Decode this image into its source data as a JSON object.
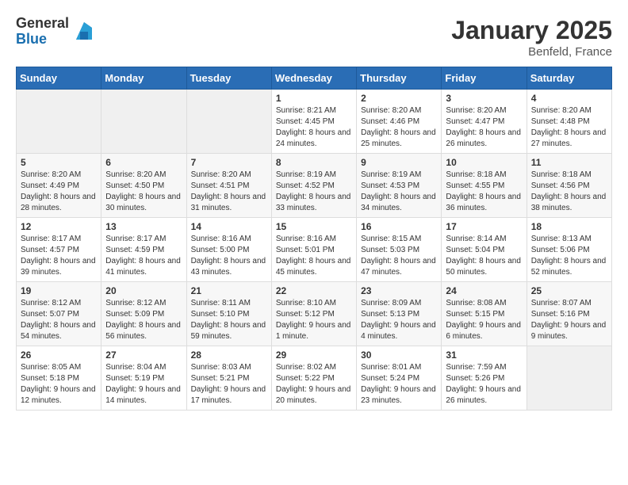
{
  "logo": {
    "general": "General",
    "blue": "Blue"
  },
  "title": "January 2025",
  "location": "Benfeld, France",
  "weekdays": [
    "Sunday",
    "Monday",
    "Tuesday",
    "Wednesday",
    "Thursday",
    "Friday",
    "Saturday"
  ],
  "weeks": [
    [
      {
        "day": "",
        "info": ""
      },
      {
        "day": "",
        "info": ""
      },
      {
        "day": "",
        "info": ""
      },
      {
        "day": "1",
        "info": "Sunrise: 8:21 AM\nSunset: 4:45 PM\nDaylight: 8 hours and 24 minutes."
      },
      {
        "day": "2",
        "info": "Sunrise: 8:20 AM\nSunset: 4:46 PM\nDaylight: 8 hours and 25 minutes."
      },
      {
        "day": "3",
        "info": "Sunrise: 8:20 AM\nSunset: 4:47 PM\nDaylight: 8 hours and 26 minutes."
      },
      {
        "day": "4",
        "info": "Sunrise: 8:20 AM\nSunset: 4:48 PM\nDaylight: 8 hours and 27 minutes."
      }
    ],
    [
      {
        "day": "5",
        "info": "Sunrise: 8:20 AM\nSunset: 4:49 PM\nDaylight: 8 hours and 28 minutes."
      },
      {
        "day": "6",
        "info": "Sunrise: 8:20 AM\nSunset: 4:50 PM\nDaylight: 8 hours and 30 minutes."
      },
      {
        "day": "7",
        "info": "Sunrise: 8:20 AM\nSunset: 4:51 PM\nDaylight: 8 hours and 31 minutes."
      },
      {
        "day": "8",
        "info": "Sunrise: 8:19 AM\nSunset: 4:52 PM\nDaylight: 8 hours and 33 minutes."
      },
      {
        "day": "9",
        "info": "Sunrise: 8:19 AM\nSunset: 4:53 PM\nDaylight: 8 hours and 34 minutes."
      },
      {
        "day": "10",
        "info": "Sunrise: 8:18 AM\nSunset: 4:55 PM\nDaylight: 8 hours and 36 minutes."
      },
      {
        "day": "11",
        "info": "Sunrise: 8:18 AM\nSunset: 4:56 PM\nDaylight: 8 hours and 38 minutes."
      }
    ],
    [
      {
        "day": "12",
        "info": "Sunrise: 8:17 AM\nSunset: 4:57 PM\nDaylight: 8 hours and 39 minutes."
      },
      {
        "day": "13",
        "info": "Sunrise: 8:17 AM\nSunset: 4:59 PM\nDaylight: 8 hours and 41 minutes."
      },
      {
        "day": "14",
        "info": "Sunrise: 8:16 AM\nSunset: 5:00 PM\nDaylight: 8 hours and 43 minutes."
      },
      {
        "day": "15",
        "info": "Sunrise: 8:16 AM\nSunset: 5:01 PM\nDaylight: 8 hours and 45 minutes."
      },
      {
        "day": "16",
        "info": "Sunrise: 8:15 AM\nSunset: 5:03 PM\nDaylight: 8 hours and 47 minutes."
      },
      {
        "day": "17",
        "info": "Sunrise: 8:14 AM\nSunset: 5:04 PM\nDaylight: 8 hours and 50 minutes."
      },
      {
        "day": "18",
        "info": "Sunrise: 8:13 AM\nSunset: 5:06 PM\nDaylight: 8 hours and 52 minutes."
      }
    ],
    [
      {
        "day": "19",
        "info": "Sunrise: 8:12 AM\nSunset: 5:07 PM\nDaylight: 8 hours and 54 minutes."
      },
      {
        "day": "20",
        "info": "Sunrise: 8:12 AM\nSunset: 5:09 PM\nDaylight: 8 hours and 56 minutes."
      },
      {
        "day": "21",
        "info": "Sunrise: 8:11 AM\nSunset: 5:10 PM\nDaylight: 8 hours and 59 minutes."
      },
      {
        "day": "22",
        "info": "Sunrise: 8:10 AM\nSunset: 5:12 PM\nDaylight: 9 hours and 1 minute."
      },
      {
        "day": "23",
        "info": "Sunrise: 8:09 AM\nSunset: 5:13 PM\nDaylight: 9 hours and 4 minutes."
      },
      {
        "day": "24",
        "info": "Sunrise: 8:08 AM\nSunset: 5:15 PM\nDaylight: 9 hours and 6 minutes."
      },
      {
        "day": "25",
        "info": "Sunrise: 8:07 AM\nSunset: 5:16 PM\nDaylight: 9 hours and 9 minutes."
      }
    ],
    [
      {
        "day": "26",
        "info": "Sunrise: 8:05 AM\nSunset: 5:18 PM\nDaylight: 9 hours and 12 minutes."
      },
      {
        "day": "27",
        "info": "Sunrise: 8:04 AM\nSunset: 5:19 PM\nDaylight: 9 hours and 14 minutes."
      },
      {
        "day": "28",
        "info": "Sunrise: 8:03 AM\nSunset: 5:21 PM\nDaylight: 9 hours and 17 minutes."
      },
      {
        "day": "29",
        "info": "Sunrise: 8:02 AM\nSunset: 5:22 PM\nDaylight: 9 hours and 20 minutes."
      },
      {
        "day": "30",
        "info": "Sunrise: 8:01 AM\nSunset: 5:24 PM\nDaylight: 9 hours and 23 minutes."
      },
      {
        "day": "31",
        "info": "Sunrise: 7:59 AM\nSunset: 5:26 PM\nDaylight: 9 hours and 26 minutes."
      },
      {
        "day": "",
        "info": ""
      }
    ]
  ]
}
